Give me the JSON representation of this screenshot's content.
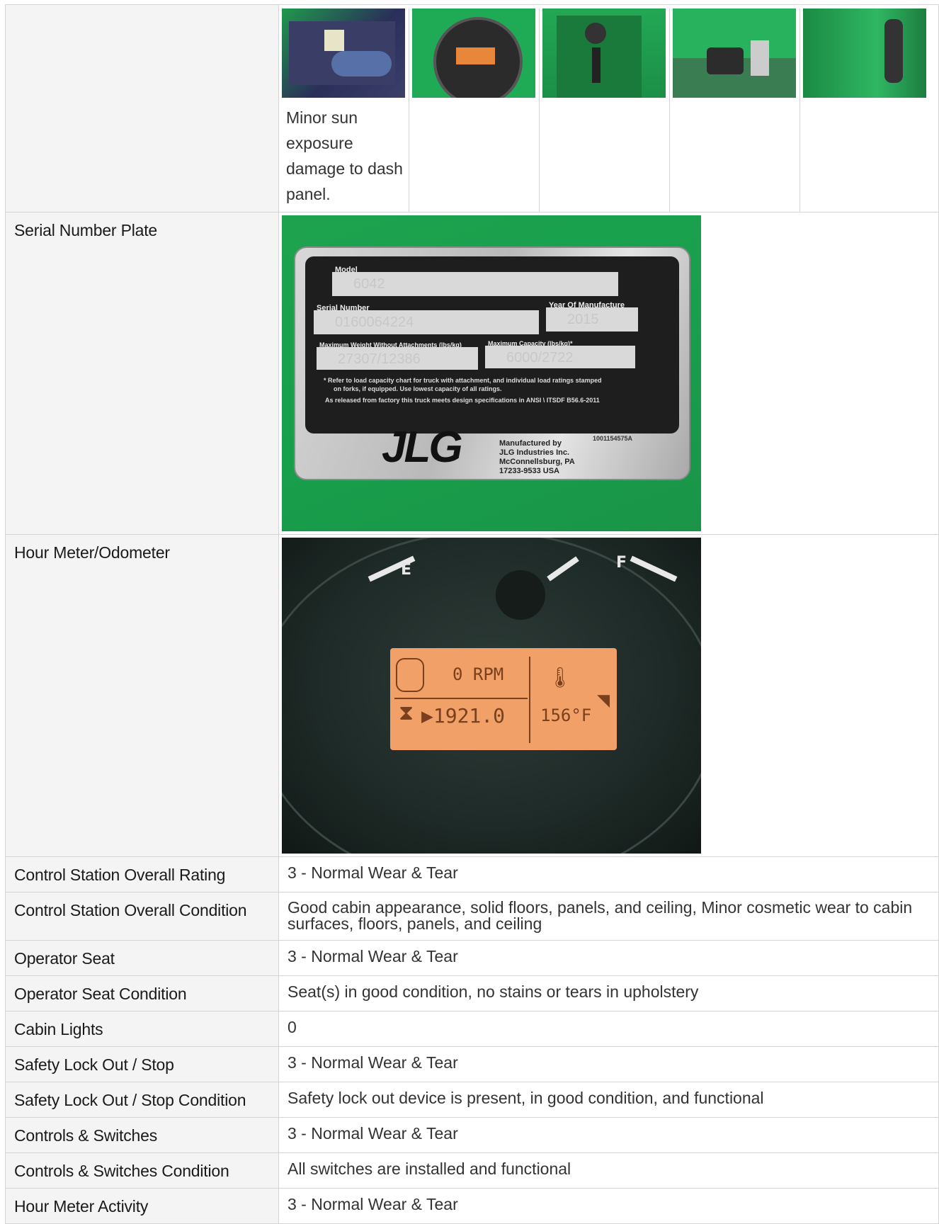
{
  "gallery": {
    "caption": "Minor sun exposure damage to dash panel."
  },
  "serial_plate": {
    "label": "Serial Number Plate",
    "model_label": "Model",
    "model_value": "6042",
    "serial_label": "Serial Number",
    "serial_value": "0160064224",
    "year_label": "Year Of Manufacture",
    "year_value": "2015",
    "max_weight_label": "Maximum Weight Without Attachments (lbs/kg)",
    "max_weight_value": "27307/12386",
    "max_capacity_label": "Maximum Capacity (lbs/kg)*",
    "max_capacity_value": "6000/2722",
    "note_line1": "* Refer to load capacity chart for truck with attachment, and individual load ratings stamped",
    "note_line2": "on forks, if equipped. Use lowest capacity of all ratings.",
    "note_line3": "As released from factory this truck meets design specifications in ANSI \\ ITSDF B56.6-2011",
    "part_number": "1001154575A",
    "brand": "JLG",
    "mfg_line1": "Manufactured by",
    "mfg_line2": "JLG Industries Inc.",
    "mfg_line3": "McConnellsburg, PA",
    "mfg_line4": "17233-9533   USA"
  },
  "hour_meter": {
    "label": "Hour Meter/Odometer",
    "gauge_e": "E",
    "gauge_f": "F",
    "rpm": "0 RPM",
    "hours": "1921.0",
    "temperature": "156°F"
  },
  "rows": [
    {
      "label": "Control Station Overall Rating",
      "value": "3 - Normal Wear & Tear"
    },
    {
      "label": "Control Station Overall Condition",
      "value": "Good cabin appearance, solid floors, panels, and ceiling, Minor cosmetic wear to cabin surfaces, floors, panels, and ceiling"
    },
    {
      "label": "Operator Seat",
      "value": "3 - Normal Wear & Tear"
    },
    {
      "label": "Operator Seat Condition",
      "value": "Seat(s) in good condition, no stains or tears in upholstery"
    },
    {
      "label": "Cabin Lights",
      "value": "0"
    },
    {
      "label": "Safety Lock Out / Stop",
      "value": "3 - Normal Wear & Tear"
    },
    {
      "label": "Safety Lock Out / Stop Condition",
      "value": "Safety lock out device is present, in good condition, and functional"
    },
    {
      "label": "Controls & Switches",
      "value": "3 - Normal Wear & Tear"
    },
    {
      "label": "Controls & Switches Condition",
      "value": "All switches are installed and functional"
    },
    {
      "label": "Hour Meter Activity",
      "value": "3 - Normal Wear & Tear"
    }
  ]
}
